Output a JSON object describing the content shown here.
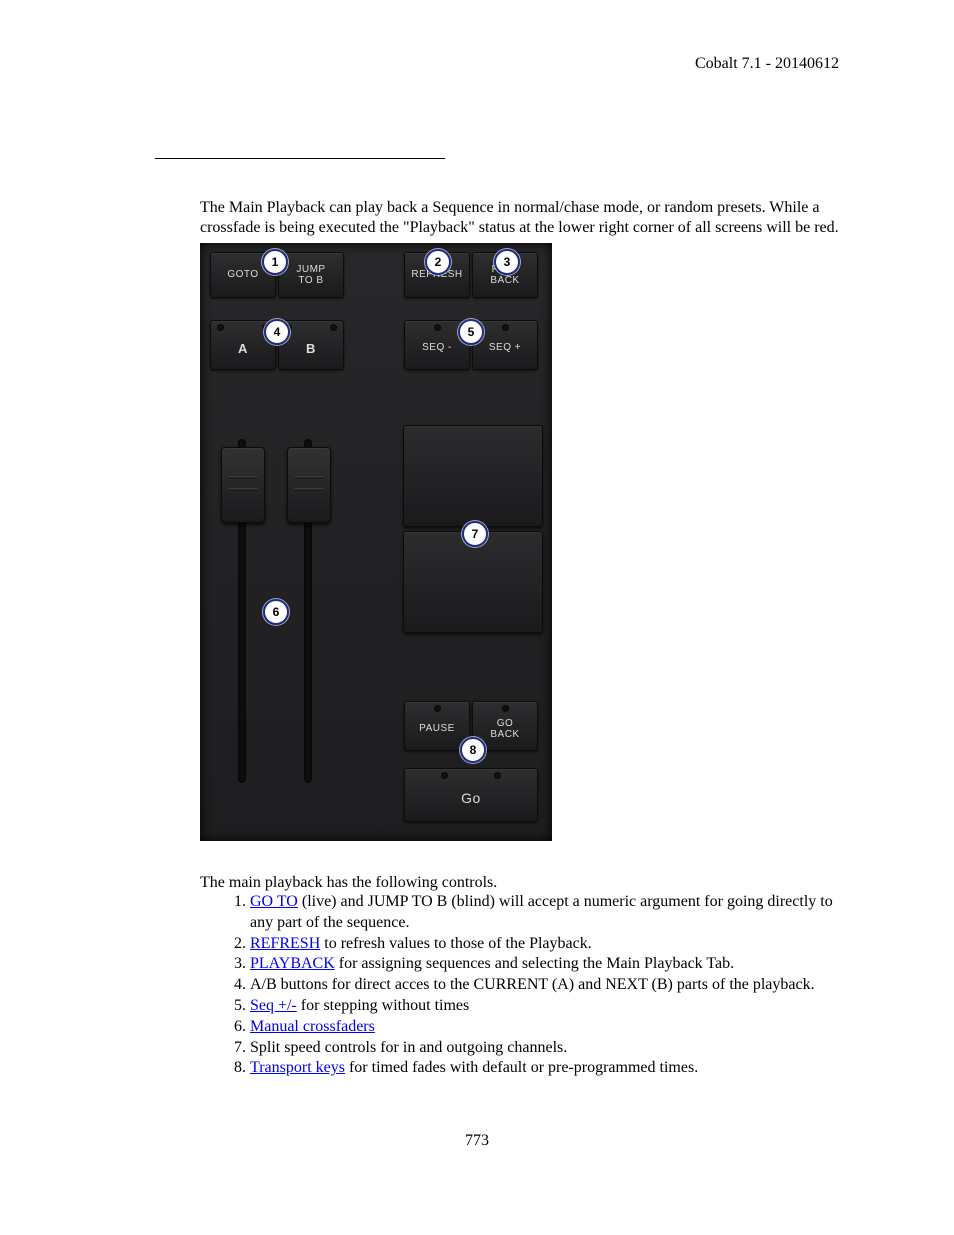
{
  "header": {
    "text": "Cobalt 7.1 - 20140612"
  },
  "intro": "The Main Playback can play back a Sequence in normal/chase mode, or random presets. While a crossfade is being executed the \"Playback\" status at the lower right corner of all screens will be red.",
  "figure": {
    "buttons": {
      "goto": "GOTO",
      "jump_to_b": "JUMP\nTO B",
      "refresh": "REFRESH",
      "play_back": "PLAY\nBACK",
      "a": "A",
      "b": "B",
      "seq_minus": "SEQ -",
      "seq_plus": "SEQ +",
      "pause": "PAUSE",
      "go_back": "GO\nBACK",
      "go": "Go"
    },
    "callouts": {
      "1": "1",
      "2": "2",
      "3": "3",
      "4": "4",
      "5": "5",
      "6": "6",
      "7": "7",
      "8": "8"
    }
  },
  "caption": "The main playback has the following controls.",
  "list": [
    {
      "link": "GO TO",
      "text": " (live) and JUMP TO B (blind) will accept a numeric argument for going directly to any part of the sequence."
    },
    {
      "link": "REFRESH",
      "text": " to refresh values to those of the Playback."
    },
    {
      "link": "PLAYBACK",
      "text": " for assigning sequences and selecting the Main Playback Tab."
    },
    {
      "link": null,
      "text": "A/B buttons for direct acces to the CURRENT (A) and NEXT (B) parts of the playback."
    },
    {
      "link": "Seq +/-",
      "text": " for stepping without times"
    },
    {
      "link": "Manual crossfaders",
      "text": ""
    },
    {
      "link": null,
      "text": "Split speed controls for in and outgoing channels."
    },
    {
      "link": "Transport keys",
      "text": " for timed fades with default or pre-programmed times."
    }
  ],
  "page_number": "773"
}
